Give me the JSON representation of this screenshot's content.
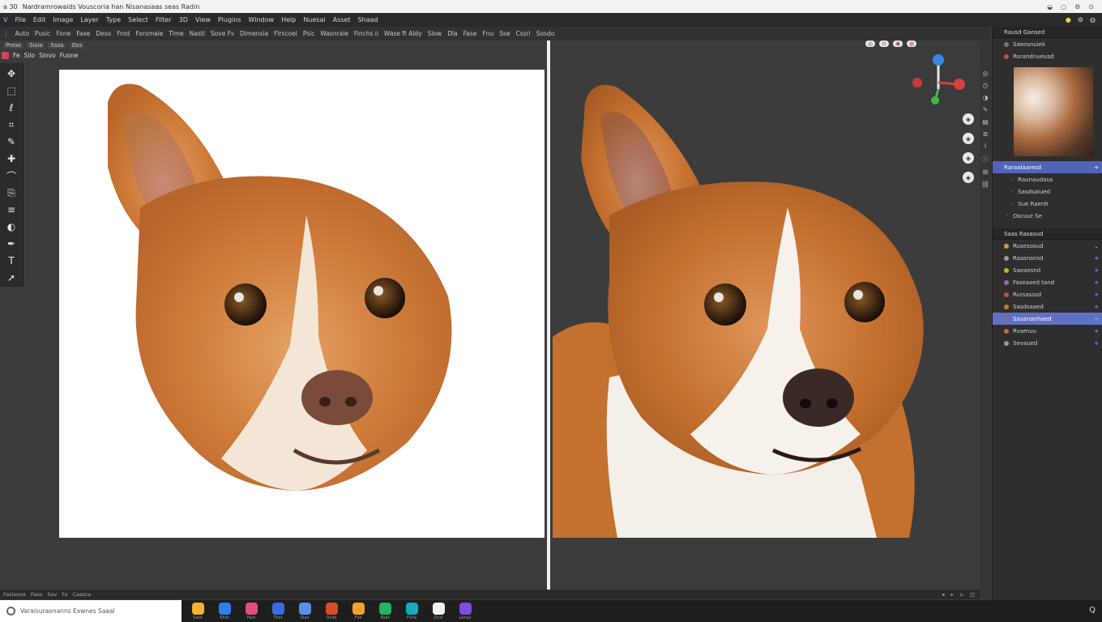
{
  "titlebar": {
    "app": "a 30",
    "title": "Nardramrowaids  Vouscoria han  Nisanasaas seas Radin"
  },
  "menubar": {
    "items": [
      "File",
      "Edit",
      "Image",
      "Layer",
      "Type",
      "Select",
      "Filter",
      "3D",
      "View",
      "Plugins",
      "Window",
      "Help",
      "Nuesal",
      "Asset",
      "Shaad"
    ],
    "right_icons": [
      "bulb-icon",
      "settings-icon",
      "account-icon"
    ]
  },
  "options": {
    "items": [
      "Auto",
      "Pusic",
      "Fone",
      "Faxe",
      "Deso",
      "Frod",
      "Forsmale",
      "Time",
      "Nastl",
      "Sove Fs",
      "Dimensia",
      "Flrscoel",
      "Psic",
      "Wasnrale",
      "Finchs ii",
      "Wase ft Aldy",
      "Slow",
      "Dla",
      "Fase",
      "Fnu",
      "Sse",
      "Cssri",
      "Sosdo"
    ]
  },
  "doc_tabs": [
    "Prese",
    "Sisia",
    "Ssos",
    "Oss"
  ],
  "doc_title": [
    "Fe",
    "Silo",
    "Sinvo",
    "Fuone"
  ],
  "toolbox": {
    "tools": [
      {
        "name": "move-tool-icon",
        "glyph": "✥"
      },
      {
        "name": "marquee-tool-icon",
        "glyph": "⬚"
      },
      {
        "name": "lasso-tool-icon",
        "glyph": "ℓ"
      },
      {
        "name": "crop-tool-icon",
        "glyph": "⌗"
      },
      {
        "name": "eyedropper-tool-icon",
        "glyph": "✎"
      },
      {
        "name": "healing-tool-icon",
        "glyph": "✚"
      },
      {
        "name": "brush-tool-icon",
        "glyph": "⌒"
      },
      {
        "name": "clone-tool-icon",
        "glyph": "⎘"
      },
      {
        "name": "eraser-tool-icon",
        "glyph": "≡"
      },
      {
        "name": "gradient-tool-icon",
        "glyph": "◐"
      },
      {
        "name": "pen-tool-icon",
        "glyph": "✒"
      },
      {
        "name": "text-tool-icon",
        "glyph": "T"
      },
      {
        "name": "pointer-tool-icon",
        "glyph": "➚"
      }
    ]
  },
  "viewport": {
    "mini_buttons": [
      "◎",
      "⊙",
      "◉",
      "◍"
    ],
    "side_buttons": [
      "◈",
      "◈",
      "◈",
      "◈"
    ]
  },
  "panel": {
    "header": "Rausd Gansed",
    "rows_top": [
      {
        "label": "Saeosnuiek",
        "dot": "#777777"
      },
      {
        "label": "Rorandnueusd",
        "dot": "#c34a5a"
      }
    ],
    "layers_header": "Raraalaaresd",
    "layers": [
      {
        "label": "Raunaudaus"
      },
      {
        "label": "Sasdsaiued"
      },
      {
        "label": "Sue Raenh"
      },
      {
        "label": "Oscuur Se"
      }
    ],
    "props_header": "Saas Rasasud",
    "props": [
      {
        "label": "Rusesosud",
        "dot": "#c8a04a",
        "arrow": "⌄"
      },
      {
        "label": "Raasnsnsd",
        "dot": "#9a9a9a",
        "arrow": "+"
      },
      {
        "label": "Saeaesnd",
        "dot": "#c8b040",
        "arrow": "+"
      },
      {
        "label": "Faseaaed tand",
        "dot": "#8a6fb0",
        "arrow": "+"
      },
      {
        "label": "Rursasssd",
        "dot": "#c34a5a",
        "arrow": "+"
      },
      {
        "label": "Sasdsaaed",
        "dot": "#c87a3a",
        "arrow": "+"
      },
      {
        "label": "Ssuananhaed",
        "dot": "#777777",
        "arrow": "+"
      },
      {
        "label": "Rvamuu",
        "dot": "#c86a3a",
        "arrow": "+"
      },
      {
        "label": "Sevaued",
        "dot": "#999999",
        "arrow": "+"
      }
    ]
  },
  "statusbar": {
    "left": [
      "Fasteoss",
      "Faso",
      "Sov",
      "Fa",
      "Cassca"
    ],
    "right": [
      "◂",
      "▸",
      "⌂",
      "◫"
    ]
  },
  "taskbar": {
    "search_text": "Varaisuraonanns  Exwnes  Saaal",
    "apps": [
      {
        "name": "app-chrome-icon",
        "color": "#f2b234",
        "label": "Sase"
      },
      {
        "name": "app-edge-icon",
        "color": "#2d7ff0",
        "label": "Shor"
      },
      {
        "name": "app-photos-icon",
        "color": "#e14f7a",
        "label": "Faro"
      },
      {
        "name": "app-messenger-icon",
        "color": "#3b6be0",
        "label": "Thor"
      },
      {
        "name": "app-store-icon",
        "color": "#5a8dea",
        "label": "Dian"
      },
      {
        "name": "app-office-icon",
        "color": "#d84a2a",
        "label": "Ocde"
      },
      {
        "name": "app-files-icon",
        "color": "#f3a22b",
        "label": "Fse"
      },
      {
        "name": "app-spotify-icon",
        "color": "#1fb561",
        "label": "Rsat"
      },
      {
        "name": "app-teams-icon",
        "color": "#17aab8",
        "label": "Flme"
      },
      {
        "name": "app-clock-icon",
        "color": "#f0f0f0",
        "label": "Ocsl"
      },
      {
        "name": "app-visual-icon",
        "color": "#7a4de0",
        "label": "Lenas"
      }
    ],
    "tray": "Q"
  }
}
